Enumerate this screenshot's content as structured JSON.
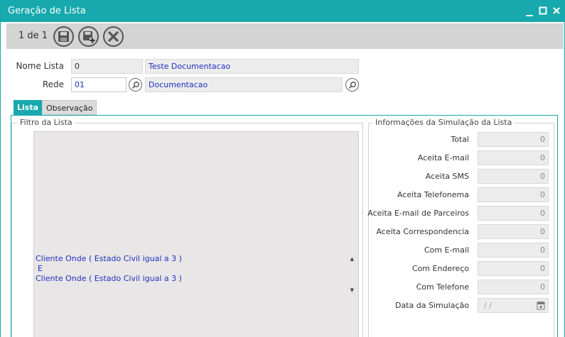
{
  "window": {
    "title": "Geração de Lista"
  },
  "toolbar": {
    "pager": "1 de 1",
    "buttons": [
      {
        "name": "save-button",
        "icon": "floppy-disk-icon"
      },
      {
        "name": "save-new-button",
        "icon": "floppy-disk-plus-icon"
      },
      {
        "name": "close-button",
        "icon": "x-circle-icon"
      }
    ]
  },
  "form": {
    "nome_lista_label": "Nome Lista",
    "nome_lista_code": "0",
    "nome_lista_value": "Teste Documentacao",
    "rede_label": "Rede",
    "rede_code": "01",
    "rede_value": "Documentacao"
  },
  "tabs": [
    {
      "label": "Lista",
      "active": true
    },
    {
      "label": "Observação",
      "active": false
    }
  ],
  "filter": {
    "legend": "Filtro da Lista",
    "lines": [
      "Cliente Onde ( Estado Civil igual a 3 )",
      "E",
      "Cliente Onde ( Estado Civil igual a 3 )"
    ]
  },
  "simulation": {
    "legend": "Informações da Simulação da Lista",
    "rows": [
      {
        "label": "Total",
        "value": "0"
      },
      {
        "label": "Aceita E-mail",
        "value": "0"
      },
      {
        "label": "Aceita SMS",
        "value": "0"
      },
      {
        "label": "Aceita Telefonema",
        "value": "0"
      },
      {
        "label": "Aceita E-mail de Parceiros",
        "value": "0"
      },
      {
        "label": "Aceita Correspondencia",
        "value": "0"
      },
      {
        "label": "Com E-mail",
        "value": "0"
      },
      {
        "label": "Com Endereço",
        "value": "0"
      },
      {
        "label": "Com Telefone",
        "value": "0"
      }
    ],
    "date_label": "Data da Simulação",
    "date_value": "/ /"
  },
  "colors": {
    "accent": "#17a9ad",
    "link_text": "#2030c0"
  }
}
